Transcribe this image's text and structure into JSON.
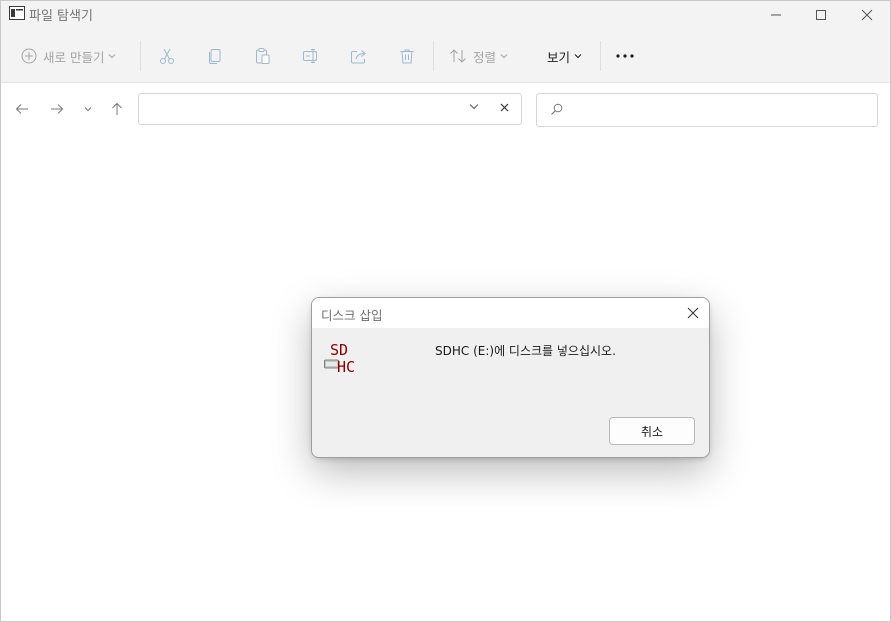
{
  "window": {
    "title": "파일 탐색기"
  },
  "toolbar": {
    "new_label": "새로 만들기",
    "sort_label": "정렬",
    "view_label": "보기",
    "icons": [
      "plus-circle-icon",
      "cut-icon",
      "copy-icon",
      "paste-icon",
      "rename-icon",
      "share-icon",
      "trash-icon",
      "sort-icon",
      "more-icon"
    ]
  },
  "address": {
    "path": "",
    "search_placeholder": ""
  },
  "dialog": {
    "title": "디스크 삽입",
    "message": "SDHC (E:)에 디스크를 넣으십시오.",
    "cancel_label": "취소",
    "icon_text": [
      "SD",
      "HC"
    ],
    "icon_text_color": "#8b0000"
  },
  "colors": {
    "chrome_bg": "#f3f3f3",
    "disabled_icon": "#9fb8d2",
    "dialog_bg": "#f0f0f0"
  }
}
